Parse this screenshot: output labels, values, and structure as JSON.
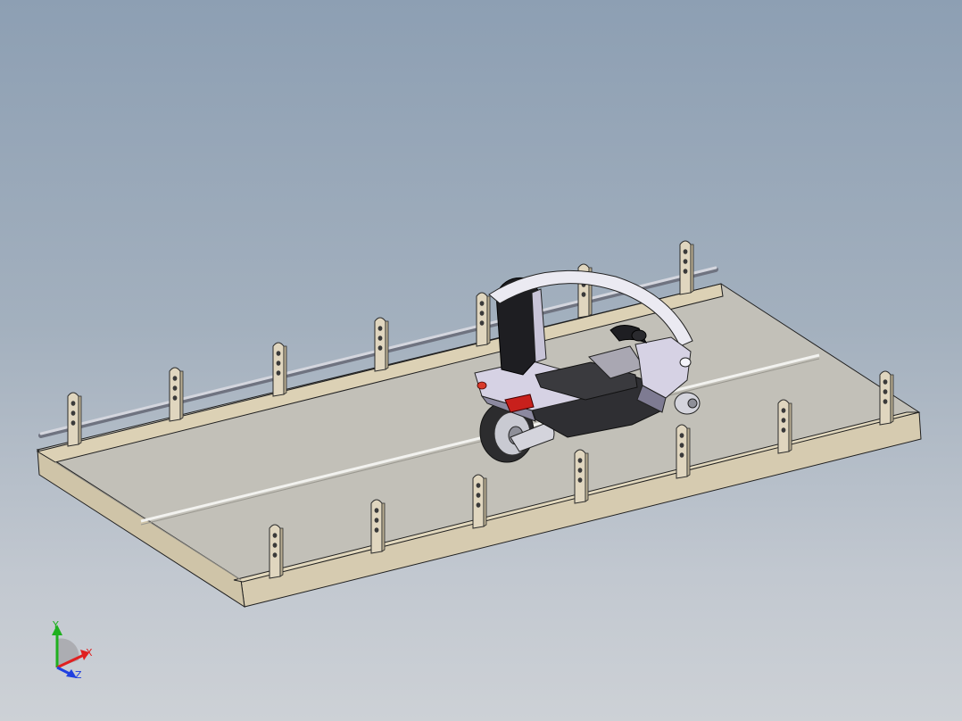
{
  "viewport": {
    "background_top": "#8d9fb3",
    "background_bottom": "#cdd1d6"
  },
  "model": {
    "platform_color": "#c2c0b8",
    "curb_color": "#d8cdb1",
    "stanchion_color": "#e0d6bf",
    "rail_color": "#b9bcc6",
    "scooter_body_color": "#d6d2e4",
    "scooter_dark_color": "#3c3c3c",
    "tail_light_color": "#c8201c"
  },
  "triad": {
    "x_label": "X",
    "y_label": "Y",
    "z_label": "Z",
    "x_color": "#e02020",
    "y_color": "#1fb01f",
    "z_color": "#2040e0"
  }
}
